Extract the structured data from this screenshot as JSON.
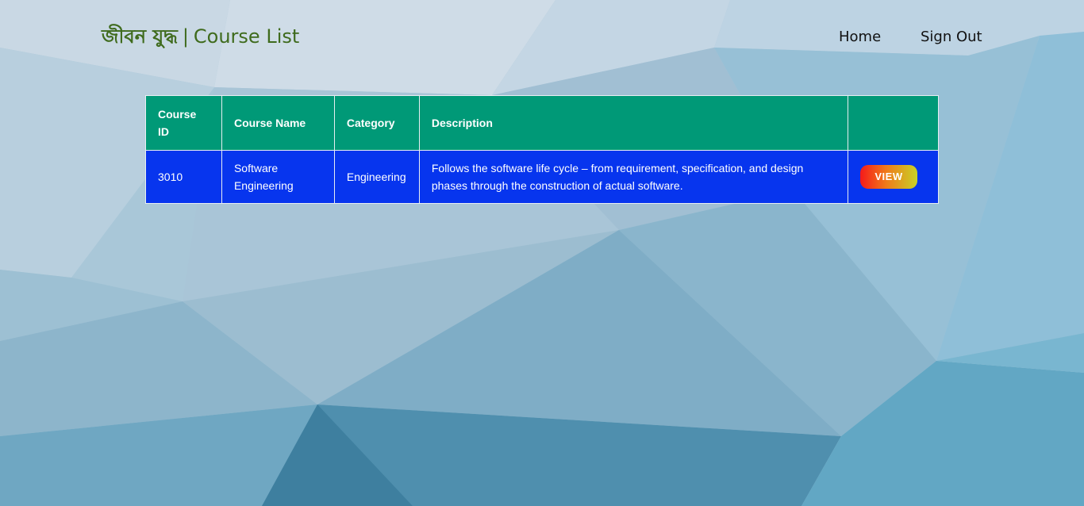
{
  "header": {
    "brand_bengali": "জীবন যুদ্ধ",
    "brand_separator": "|",
    "brand_title": "Course List"
  },
  "nav": {
    "home": "Home",
    "sign_out": "Sign Out"
  },
  "table": {
    "headers": [
      "Course ID",
      "Course Name",
      "Category",
      "Description",
      ""
    ],
    "rows": [
      {
        "course_id": "3010",
        "course_name": "Software Engineering",
        "category": "Engineering",
        "description": "Follows the software life cycle – from requirement, specification, and design phases through the construction of actual software.",
        "action_label": "VIEW"
      }
    ]
  },
  "colors": {
    "brand_text": "#3f6b1d",
    "header_bg": "#009977",
    "row_bg": "#0735ee"
  }
}
